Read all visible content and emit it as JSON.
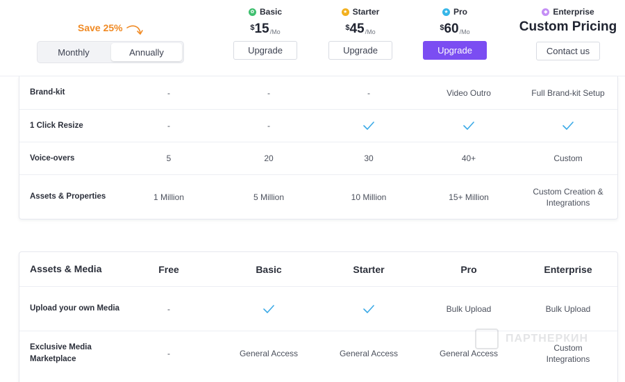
{
  "billing": {
    "save_badge": "Save 25%",
    "monthly_label": "Monthly",
    "annually_label": "Annually",
    "selected": "Annually"
  },
  "plans": [
    {
      "name": "Basic",
      "icon": "leaf-icon",
      "icon_color": "#3fbf6f",
      "currency": "$",
      "price": "15",
      "period": "/Mo",
      "cta": "Upgrade"
    },
    {
      "name": "Starter",
      "icon": "star-icon",
      "icon_color": "#f2b01e",
      "currency": "$",
      "price": "45",
      "period": "/Mo",
      "cta": "Upgrade"
    },
    {
      "name": "Pro",
      "icon": "star-icon",
      "icon_color": "#35b6e8",
      "currency": "$",
      "price": "60",
      "period": "/Mo",
      "cta": "Upgrade"
    },
    {
      "name": "Enterprise",
      "icon": "diamond-icon",
      "icon_color": "#c48ef5",
      "custom_price": "Custom Pricing",
      "cta": "Contact us"
    }
  ],
  "colors": {
    "accent": "#7b4df2",
    "check": "#3aa9e6",
    "save": "#f08a24"
  },
  "table1": {
    "rows": [
      {
        "label": "Brand-kit",
        "cells": [
          "-",
          "-",
          "-",
          "Video Outro",
          "Full Brand-kit Setup"
        ]
      },
      {
        "label": "1 Click Resize",
        "cells": [
          "-",
          "-",
          "check",
          "check",
          "check"
        ]
      },
      {
        "label": "Voice-overs",
        "cells": [
          "5",
          "20",
          "30",
          "40+",
          "Custom"
        ]
      },
      {
        "label": "Assets & Properties",
        "cells": [
          "1 Million",
          "5 Million",
          "10 Million",
          "15+ Million",
          "Custom Creation & Integrations"
        ]
      }
    ]
  },
  "table2": {
    "header": {
      "label": "Assets & Media",
      "columns": [
        "Free",
        "Basic",
        "Starter",
        "Pro",
        "Enterprise"
      ]
    },
    "rows": [
      {
        "label": "Upload your own Media",
        "cells": [
          "-",
          "check",
          "check",
          "Bulk Upload",
          "Bulk Upload"
        ]
      },
      {
        "label": "Exclusive Media Marketplace",
        "cells": [
          "-",
          "General Access",
          "General Access",
          "General Access",
          "Custom Integrations"
        ]
      }
    ]
  },
  "watermark": "ПАРТНЕРКИН"
}
